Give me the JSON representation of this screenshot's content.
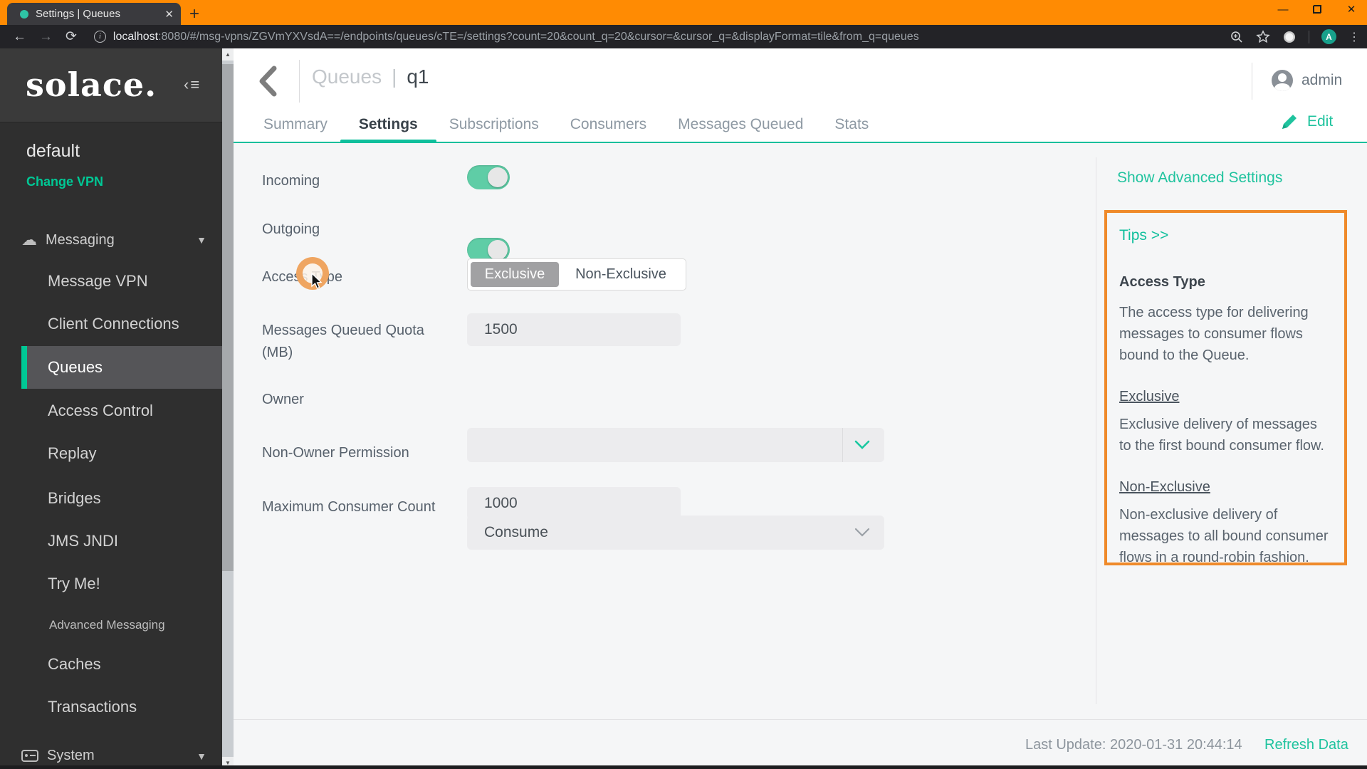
{
  "browser": {
    "tab_title": "Settings | Queues",
    "close_tab_glyph": "✕",
    "new_tab_glyph": "+",
    "url_host": "localhost",
    "url_rest": ":8080/#/msg-vpns/ZGVmYXVsdA==/endpoints/queues/cTE=/settings?count=20&count_q=20&cursor=&cursor_q=&displayFormat=tile&from_q=queues",
    "avatar_letter": "A",
    "colors": {
      "frame_orange": "#ff8b03",
      "favicon_teal": "#2ec4a5",
      "chrome_dark": "#232327"
    }
  },
  "sidebar": {
    "logo_text": "solace.",
    "vpn_name": "default",
    "change_vpn_label": "Change VPN",
    "messaging_section": "Messaging",
    "system_section": "System",
    "items": [
      {
        "label": "Message VPN"
      },
      {
        "label": "Client Connections"
      },
      {
        "label": "Queues"
      },
      {
        "label": "Access Control"
      },
      {
        "label": "Replay"
      },
      {
        "label": "Bridges"
      },
      {
        "label": "JMS JNDI"
      },
      {
        "label": "Try Me!"
      },
      {
        "label": "Advanced Messaging"
      },
      {
        "label": "Caches"
      },
      {
        "label": "Transactions"
      }
    ],
    "selected_item": "Queues"
  },
  "header": {
    "breadcrumb_parent": "Queues",
    "breadcrumb_divider": "|",
    "breadcrumb_current": "q1",
    "user_name": "admin",
    "edit_label": "Edit"
  },
  "tabs": {
    "items": [
      "Summary",
      "Settings",
      "Subscriptions",
      "Consumers",
      "Messages Queued",
      "Stats"
    ],
    "active": "Settings"
  },
  "form": {
    "incoming_label": "Incoming",
    "incoming_value": "on",
    "outgoing_label": "Outgoing",
    "outgoing_value": "on",
    "access_type_label": "Access Type",
    "access_type_options": [
      "Exclusive",
      "Non-Exclusive"
    ],
    "access_type_selected": "Exclusive",
    "quota_label": "Messages Queued Quota (MB)",
    "quota_value": "1500",
    "owner_label": "Owner",
    "owner_value": "",
    "non_owner_label": "Non-Owner Permission",
    "non_owner_value": "Consume",
    "max_consumer_label": "Maximum Consumer Count",
    "max_consumer_value": "1000"
  },
  "right_rail": {
    "show_advanced_label": "Show Advanced Settings",
    "tips_title": "Tips >>",
    "tips_heading": "Access Type",
    "tips_body": "The access type for delivering messages to consumer flows bound to the Queue.",
    "sections": [
      {
        "term": "Exclusive",
        "desc": "Exclusive delivery of messages to the first bound consumer flow."
      },
      {
        "term": "Non-Exclusive",
        "desc": "Non-exclusive delivery of messages to all bound consumer flows in a round-robin fashion."
      }
    ],
    "tips_border_color": "#ef8a2a"
  },
  "footer": {
    "last_update": "Last Update: 2020-01-31 20:44:14",
    "refresh_label": "Refresh Data"
  },
  "theme": {
    "accent_teal": "#00c895",
    "toggle_teal": "#5fcda6",
    "selected_row_gray": "#555558"
  }
}
